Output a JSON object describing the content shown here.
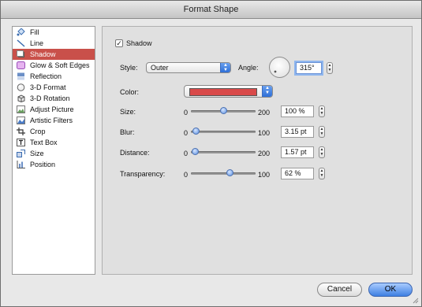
{
  "window": {
    "title": "Format Shape"
  },
  "sidebar": {
    "items": [
      {
        "label": "Fill",
        "icon": "fill-icon",
        "selected": false
      },
      {
        "label": "Line",
        "icon": "line-icon",
        "selected": false
      },
      {
        "label": "Shadow",
        "icon": "shadow-icon",
        "selected": true
      },
      {
        "label": "Glow & Soft Edges",
        "icon": "glow-icon",
        "selected": false
      },
      {
        "label": "Reflection",
        "icon": "reflection-icon",
        "selected": false
      },
      {
        "label": "3-D Format",
        "icon": "3d-format-icon",
        "selected": false
      },
      {
        "label": "3-D Rotation",
        "icon": "3d-rotation-icon",
        "selected": false
      },
      {
        "label": "Adjust Picture",
        "icon": "adjust-picture-icon",
        "selected": false
      },
      {
        "label": "Artistic Filters",
        "icon": "artistic-filters-icon",
        "selected": false
      },
      {
        "label": "Crop",
        "icon": "crop-icon",
        "selected": false
      },
      {
        "label": "Text Box",
        "icon": "text-box-icon",
        "selected": false
      },
      {
        "label": "Size",
        "icon": "size-icon",
        "selected": false
      },
      {
        "label": "Position",
        "icon": "position-icon",
        "selected": false
      }
    ]
  },
  "shadow": {
    "checkbox_label": "Shadow",
    "checked": true,
    "style_label": "Style:",
    "style_value": "Outer",
    "angle_label": "Angle:",
    "angle_value": "315°",
    "color_label": "Color:",
    "color_value": "#d94a4a",
    "size": {
      "label": "Size:",
      "min": "0",
      "max": "200",
      "value": "100 %",
      "level": 0.5
    },
    "blur": {
      "label": "Blur:",
      "min": "0",
      "max": "100",
      "value": "3.15 pt",
      "level": 0.03
    },
    "distance": {
      "label": "Distance:",
      "min": "0",
      "max": "200",
      "value": "1.57 pt",
      "level": 0.01
    },
    "transparency": {
      "label": "Transparency:",
      "min": "0",
      "max": "100",
      "value": "62 %",
      "level": 0.62
    }
  },
  "buttons": {
    "cancel": "Cancel",
    "ok": "OK"
  },
  "colors": {
    "accent": "#3d7fe2",
    "selection": "#c9504a"
  }
}
